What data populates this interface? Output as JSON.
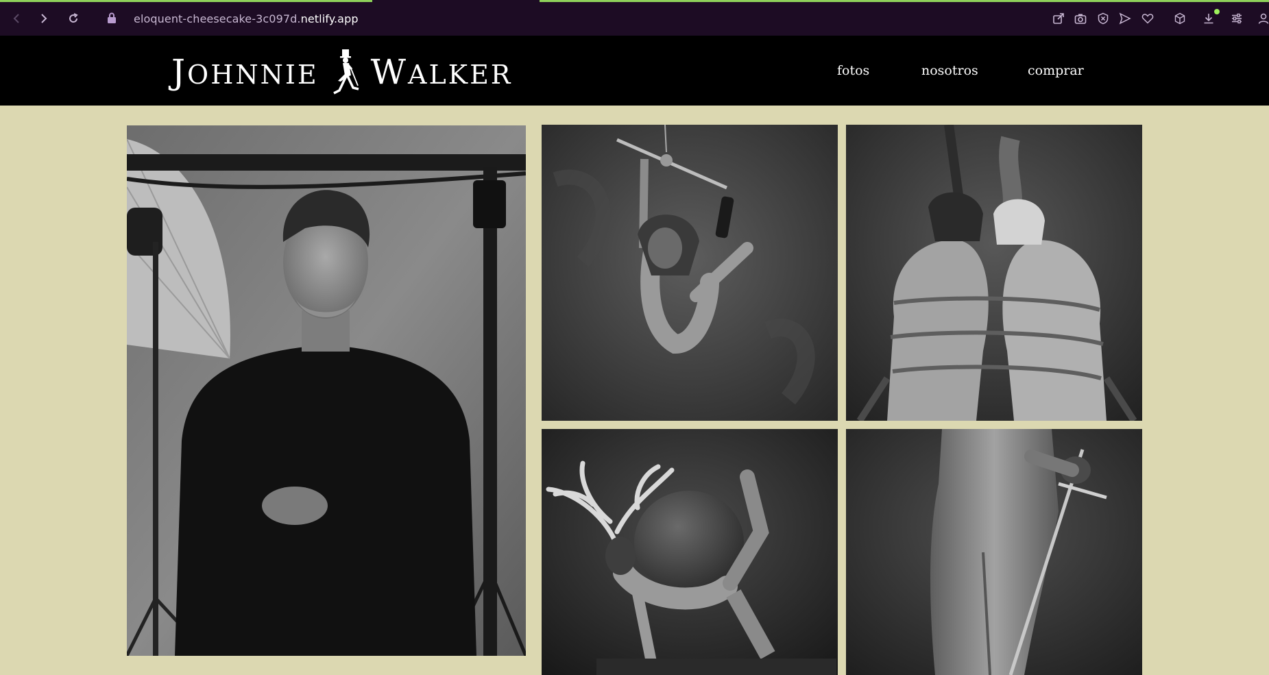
{
  "browser": {
    "url_prefix": "eloquent-cheesecake-3c097d.",
    "url_domain": "netlify.app",
    "icons": [
      "back-icon",
      "forward-icon",
      "reload-icon",
      "lock-icon",
      "share-icon",
      "camera-icon",
      "block-icon",
      "send-icon",
      "heart-icon",
      "box-icon",
      "download-icon",
      "settings-icon",
      "profile-icon"
    ]
  },
  "site": {
    "logo_left": "JOHNNIE",
    "logo_right": "WALKER",
    "nav": {
      "fotos": "fotos",
      "nosotros": "nosotros",
      "comprar": "comprar"
    }
  },
  "gallery": {
    "photos": [
      "portrait of a man in a black sweater in a photo studio",
      "suspended figure with helmet on dark background",
      "two embracing figures bound in rope wearing helmets",
      "figure with antlers carrying a large boulder",
      "standing figure holding a sword"
    ]
  },
  "colors": {
    "page_background": "#dcd8b1",
    "header_background": "#000000",
    "browser_bar": "#1d0c24",
    "accent": "#8ed15a"
  }
}
